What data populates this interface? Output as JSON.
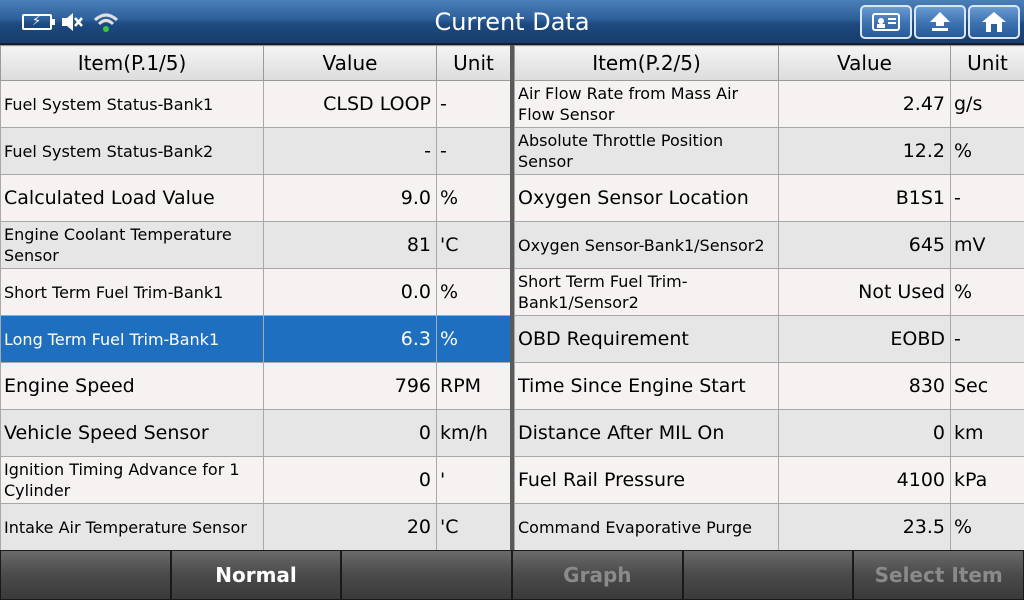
{
  "header": {
    "title": "Current Data",
    "icons": [
      "battery-icon",
      "mute-icon",
      "wifi-icon",
      "report-icon",
      "back-icon",
      "home-icon"
    ]
  },
  "left_table": {
    "headers": {
      "item": "Item(P.1/5)",
      "value": "Value",
      "unit": "Unit"
    },
    "rows": [
      {
        "item": "Fuel System Status-Bank1",
        "value": "CLSD LOOP",
        "unit": "-"
      },
      {
        "item": "Fuel System Status-Bank2",
        "value": "-",
        "unit": "-"
      },
      {
        "item": "Calculated Load Value",
        "value": "9.0",
        "unit": "%"
      },
      {
        "item": "Engine Coolant Temperature Sensor",
        "value": "81",
        "unit": "'C"
      },
      {
        "item": "Short Term Fuel Trim-Bank1",
        "value": "0.0",
        "unit": "%"
      },
      {
        "item": "Long Term Fuel Trim-Bank1",
        "value": "6.3",
        "unit": "%"
      },
      {
        "item": "Engine Speed",
        "value": "796",
        "unit": "RPM"
      },
      {
        "item": "Vehicle Speed Sensor",
        "value": "0",
        "unit": "km/h"
      },
      {
        "item": "Ignition Timing Advance for 1 Cylinder",
        "value": "0",
        "unit": "'"
      },
      {
        "item": "Intake Air Temperature Sensor",
        "value": "20",
        "unit": "'C"
      }
    ]
  },
  "right_table": {
    "headers": {
      "item": "Item(P.2/5)",
      "value": "Value",
      "unit": "Unit"
    },
    "rows": [
      {
        "item": "Air Flow Rate from Mass Air Flow Sensor",
        "value": "2.47",
        "unit": "g/s"
      },
      {
        "item": "Absolute Throttle Position Sensor",
        "value": "12.2",
        "unit": "%"
      },
      {
        "item": "Oxygen Sensor Location",
        "value": "B1S1",
        "unit": "-"
      },
      {
        "item": "Oxygen Sensor-Bank1/Sensor2",
        "value": "645",
        "unit": "mV"
      },
      {
        "item": "Short Term Fuel Trim-Bank1/Sensor2",
        "value": "Not Used",
        "unit": "%"
      },
      {
        "item": "OBD Requirement",
        "value": "EOBD",
        "unit": "-"
      },
      {
        "item": "Time Since Engine Start",
        "value": "830",
        "unit": "Sec"
      },
      {
        "item": "Distance After MIL On",
        "value": "0",
        "unit": "km"
      },
      {
        "item": "Fuel Rail Pressure",
        "value": "4100",
        "unit": "kPa"
      },
      {
        "item": "Command Evaporative Purge",
        "value": "23.5",
        "unit": "%"
      }
    ]
  },
  "bottom_bar": {
    "buttons": [
      "",
      "Normal",
      "",
      "Graph",
      "",
      "Select Item"
    ]
  },
  "colors": {
    "selected_row": "#1f6fc0",
    "title_bar": "#2d5f99"
  }
}
